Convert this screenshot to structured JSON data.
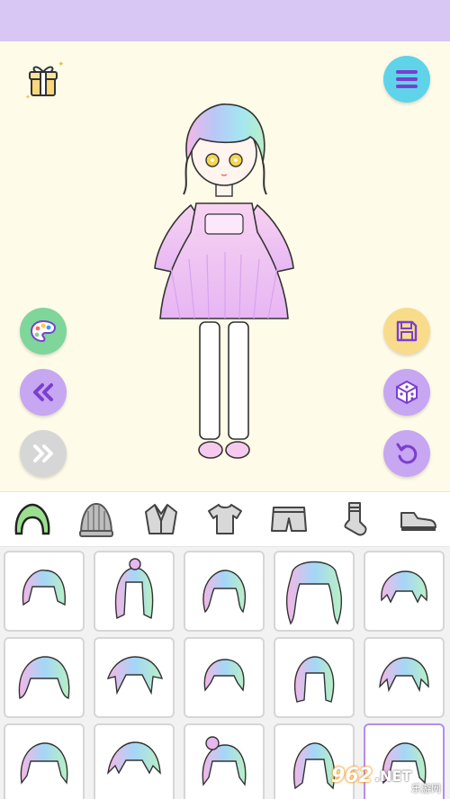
{
  "colors": {
    "top_bar": "#d8c6f4",
    "stage_bg": "#fefbe8",
    "menu_btn": "#5fd3ea",
    "palette_btn": "#7ed69a",
    "nav_btn": "#c7a6f2",
    "save_btn": "#f9dc8b",
    "random_btn": "#c7a6f2",
    "undo_btn": "#c7a6f2",
    "selected_tile_border": "#b58cf0"
  },
  "stage": {
    "gift_icon": "gift-icon",
    "menu_icon": "hamburger-menu-icon",
    "palette_icon": "palette-icon",
    "prev_icon": "double-chevron-left-icon",
    "next_icon": "double-chevron-right-icon",
    "save_icon": "floppy-disk-icon",
    "random_icon": "dice-icon",
    "undo_icon": "undo-arrow-icon"
  },
  "categories": [
    {
      "name": "hair",
      "icon": "hair-icon",
      "active": true
    },
    {
      "name": "hat",
      "icon": "knit-hat-icon",
      "active": false
    },
    {
      "name": "jacket",
      "icon": "jacket-icon",
      "active": false
    },
    {
      "name": "top",
      "icon": "t-shirt-icon",
      "active": false
    },
    {
      "name": "bottom",
      "icon": "shorts-icon",
      "active": false
    },
    {
      "name": "socks",
      "icon": "sock-icon",
      "active": false
    },
    {
      "name": "shoes",
      "icon": "shoe-icon",
      "active": false
    }
  ],
  "hair_options_count_visible": 15,
  "selected_hair_index": 14,
  "watermark": {
    "logo": "962",
    "suffix": ".NET",
    "sub": "乐游网"
  }
}
